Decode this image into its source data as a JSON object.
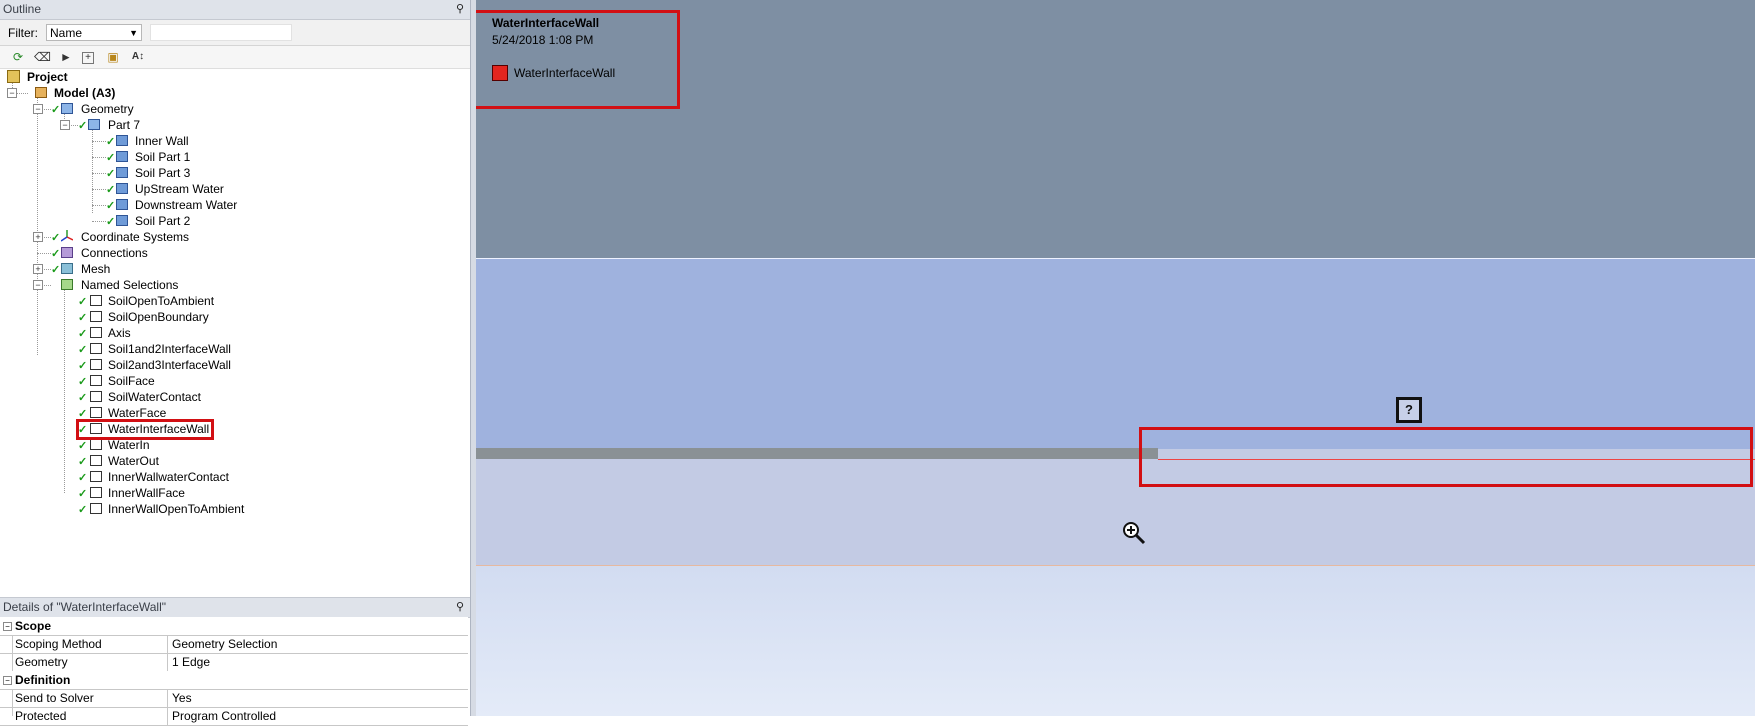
{
  "outline": {
    "title": "Outline",
    "pin": "⚲",
    "filter_label": "Filter:",
    "filter_value": "Name",
    "filter_text": ""
  },
  "toolbar": {
    "icons": [
      "refresh-icon",
      "eraser-icon",
      "tree-filter-icon",
      "expand-all-icon",
      "folder-icon",
      "sort-az-icon"
    ]
  },
  "tree": {
    "project": "Project",
    "model": "Model (A3)",
    "geometry": "Geometry",
    "part": "Part 7",
    "bodies": [
      "Inner Wall",
      "Soil Part 1",
      "Soil Part 3",
      "UpStream Water",
      "Downstream Water",
      "Soil Part 2"
    ],
    "coordinate_systems": "Coordinate Systems",
    "connections": "Connections",
    "mesh": "Mesh",
    "named_selections": "Named Selections",
    "selections": [
      "SoilOpenToAmbient",
      "SoilOpenBoundary",
      "Axis",
      "Soil1and2InterfaceWall",
      "Soil2and3InterfaceWall",
      "SoilFace",
      "SoilWaterContact",
      "WaterFace",
      "WaterInterfaceWall",
      "WaterIn",
      "WaterOut",
      "InnerWallwaterContact",
      "InnerWallFace",
      "InnerWallOpenToAmbient"
    ]
  },
  "details": {
    "title": "Details of \"WaterInterfaceWall\"",
    "sections": [
      {
        "name": "Scope",
        "rows": [
          {
            "key": "Scoping Method",
            "value": "Geometry Selection"
          },
          {
            "key": "Geometry",
            "value": "1 Edge"
          }
        ]
      },
      {
        "name": "Definition",
        "rows": [
          {
            "key": "Send to Solver",
            "value": "Yes"
          },
          {
            "key": "Protected",
            "value": "Program Controlled"
          }
        ]
      }
    ]
  },
  "viewport": {
    "legend_title": "WaterInterfaceWall",
    "legend_date": "5/24/2018 1:08 PM",
    "legend_item": "WaterInterfaceWall",
    "legend_color": "#e3251f",
    "help_glyph": "?"
  },
  "colors": {
    "highlight": "#d20f13",
    "check": "#1a9a1a"
  }
}
